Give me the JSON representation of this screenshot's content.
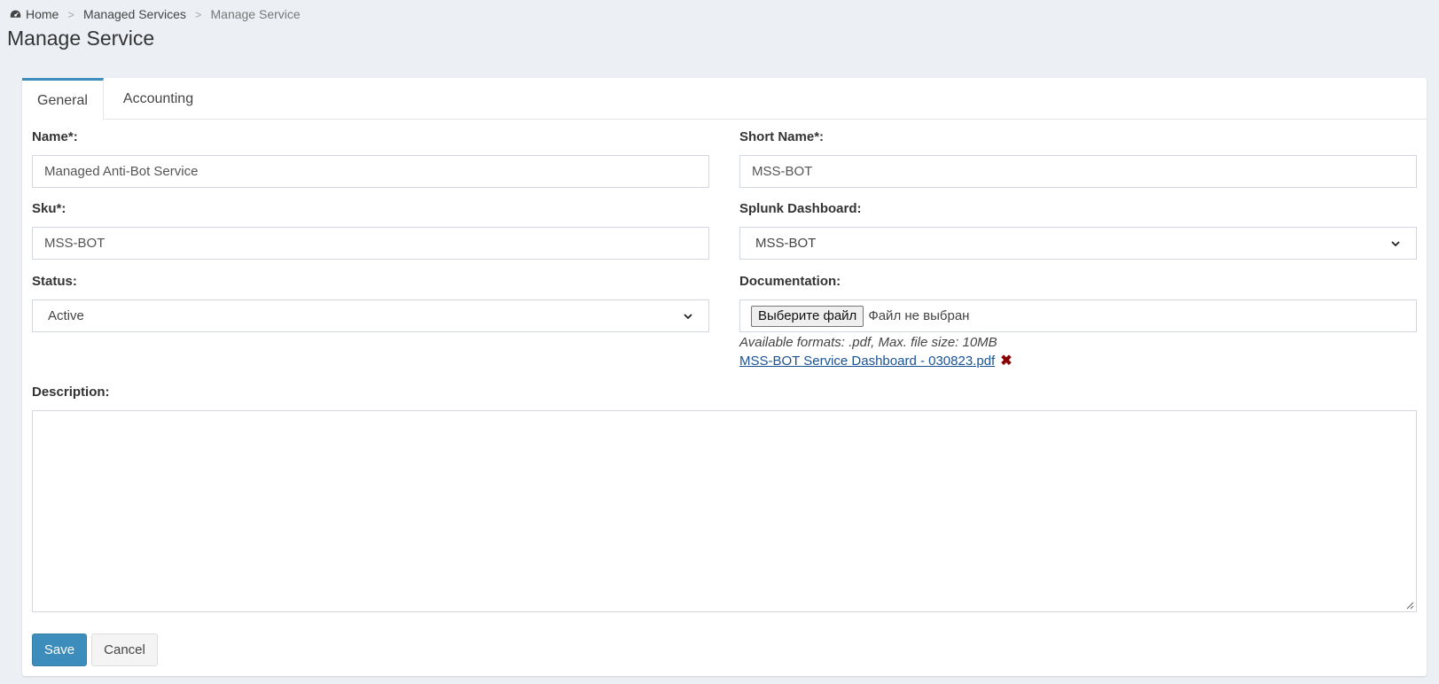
{
  "breadcrumb": {
    "home": "Home",
    "sep1": ">",
    "managed_services": "Managed Services",
    "sep2": ">",
    "current": "Manage Service"
  },
  "page_title": "Manage Service",
  "tabs": [
    {
      "label": "General",
      "active": true
    },
    {
      "label": "Accounting",
      "active": false
    }
  ],
  "form": {
    "name": {
      "label": "Name",
      "required_mark": "*",
      "colon": ":",
      "value": "Managed Anti-Bot Service"
    },
    "short_name": {
      "label": "Short Name",
      "required_mark": "*",
      "colon": ":",
      "value": "MSS-BOT"
    },
    "sku": {
      "label": "Sku",
      "required_mark": "*",
      "colon": ":",
      "value": "MSS-BOT"
    },
    "splunk_dashboard": {
      "label": "Splunk Dashboard:",
      "value": "MSS-BOT"
    },
    "status": {
      "label": "Status:",
      "value": "Active"
    },
    "documentation": {
      "label": "Documentation:",
      "choose_button": "Выберите файл",
      "file_status": "Файл не выбран",
      "help": "Available formats: .pdf, Max. file size: 10MB",
      "current_file": "MSS-BOT Service Dashboard - 030823.pdf",
      "remove_glyph": "✖"
    },
    "description": {
      "label": "Description:",
      "value": ""
    }
  },
  "buttons": {
    "save": "Save",
    "cancel": "Cancel"
  },
  "colors": {
    "primary": "#3c8dbc",
    "background": "#ecf0f5",
    "link": "#1a5296",
    "remove": "#8b0000"
  }
}
